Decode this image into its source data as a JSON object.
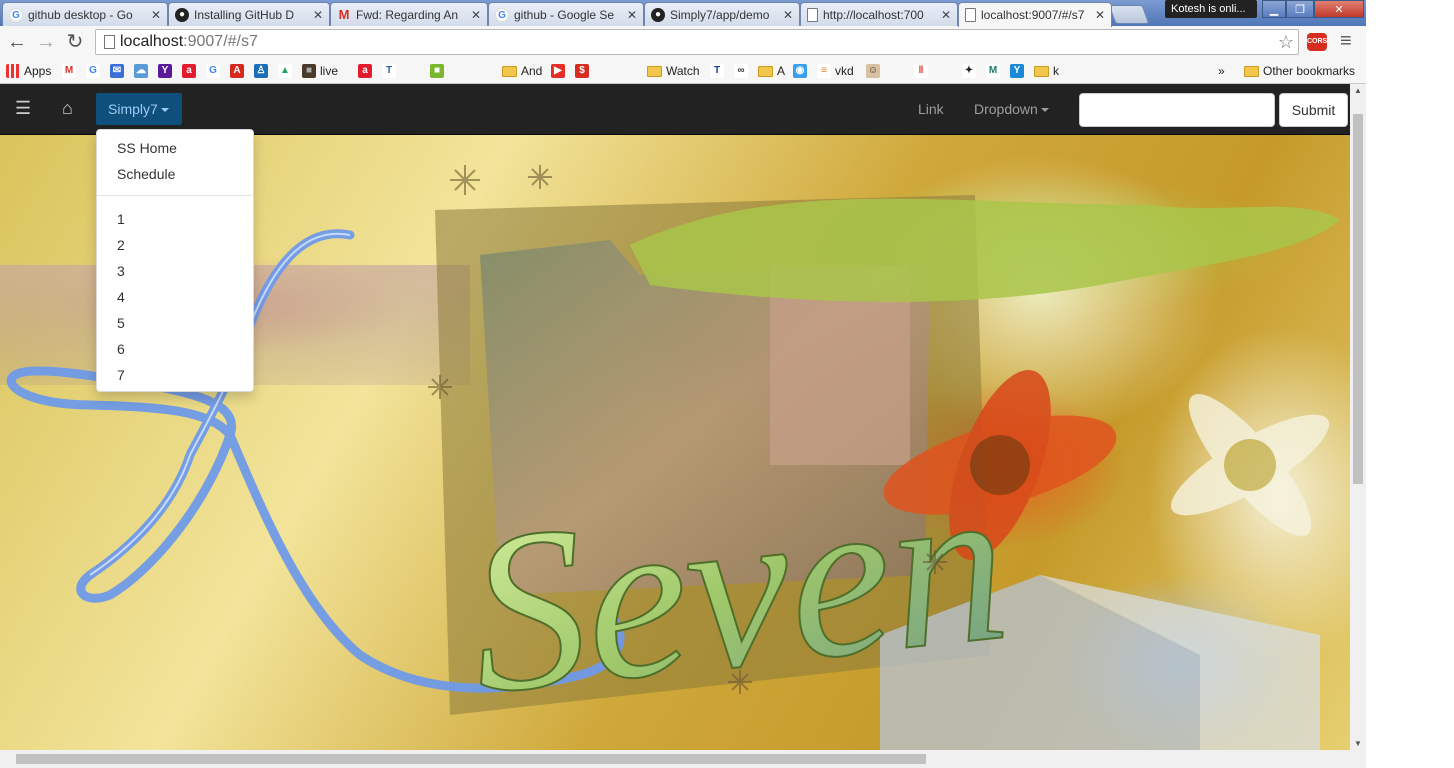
{
  "tabs": [
    {
      "title": "github desktop - Go",
      "favicon": "google-icon"
    },
    {
      "title": "Installing GitHub D",
      "favicon": "github-icon"
    },
    {
      "title": "Fwd: Regarding An",
      "favicon": "gmail-icon"
    },
    {
      "title": "github - Google Se",
      "favicon": "google-icon"
    },
    {
      "title": "Simply7/app/demo",
      "favicon": "github-icon"
    },
    {
      "title": "http://localhost:700",
      "favicon": "page-icon"
    },
    {
      "title": "localhost:9007/#/s7",
      "favicon": "page-icon",
      "active": true
    }
  ],
  "notification": "Kotesh is onli...",
  "address": {
    "host": "localhost",
    "path": ":9007/#/s7"
  },
  "extension_cors": "CORS",
  "bookmarks": [
    {
      "label": "Apps",
      "icon": "apps-icon"
    },
    {
      "label": "",
      "icon": "gmail-icon"
    },
    {
      "label": "",
      "icon": "google-icon"
    },
    {
      "label": "",
      "icon": "mail-icon"
    },
    {
      "label": "",
      "icon": "cloud-icon"
    },
    {
      "label": "",
      "icon": "yahoo-icon"
    },
    {
      "label": "",
      "icon": "airtel-icon"
    },
    {
      "label": "",
      "icon": "google-icon"
    },
    {
      "label": "",
      "icon": "act-icon"
    },
    {
      "label": "",
      "icon": "person-icon"
    },
    {
      "label": "",
      "icon": "drive-icon"
    },
    {
      "label": "live",
      "icon": "photo-icon"
    },
    {
      "label": "",
      "icon": "airtel-icon"
    },
    {
      "label": "",
      "icon": "tz-icon"
    },
    {
      "label": "",
      "icon": "page-icon"
    },
    {
      "label": "",
      "icon": "green-icon"
    },
    {
      "label": "",
      "icon": "page-icon"
    },
    {
      "label": "",
      "icon": "page-icon"
    },
    {
      "label": "And",
      "icon": "folder-icon"
    },
    {
      "label": "",
      "icon": "youtube-icon"
    },
    {
      "label": "",
      "icon": "dollar-icon"
    },
    {
      "label": "",
      "icon": "page-icon"
    },
    {
      "label": "",
      "icon": "page-icon"
    },
    {
      "label": "Watch",
      "icon": "folder-icon"
    },
    {
      "label": "",
      "icon": "tr-icon"
    },
    {
      "label": "",
      "icon": "glasses-icon"
    },
    {
      "label": "A",
      "icon": "folder-icon"
    },
    {
      "label": "",
      "icon": "chat-icon"
    },
    {
      "label": "vkd",
      "icon": "stack-icon"
    },
    {
      "label": "",
      "icon": "avatar-icon"
    },
    {
      "label": "",
      "icon": "page-icon"
    },
    {
      "label": "",
      "icon": "pause-icon"
    },
    {
      "label": "",
      "icon": "page-icon"
    },
    {
      "label": "",
      "icon": "bird-icon"
    },
    {
      "label": "",
      "icon": "m-icon"
    },
    {
      "label": "",
      "icon": "yammer-icon"
    },
    {
      "label": "k",
      "icon": "folder-icon"
    }
  ],
  "bookmarks_overflow": "»",
  "other_bookmarks": "Other bookmarks",
  "navbar": {
    "brand": "Simply7",
    "link": "Link",
    "dropdown": "Dropdown",
    "search_value": "",
    "submit": "Submit"
  },
  "dropdown_menu": {
    "header_items": [
      "SS Home",
      "Schedule"
    ],
    "numbered_items": [
      "1",
      "2",
      "3",
      "4",
      "5",
      "6",
      "7"
    ]
  },
  "hero_text": "Seven",
  "colors": {
    "navbar_bg": "#222222",
    "brand_active_bg": "#0e4f7b",
    "brand_text": "#9ecbf0",
    "ribbon": "#6f9ae8"
  }
}
